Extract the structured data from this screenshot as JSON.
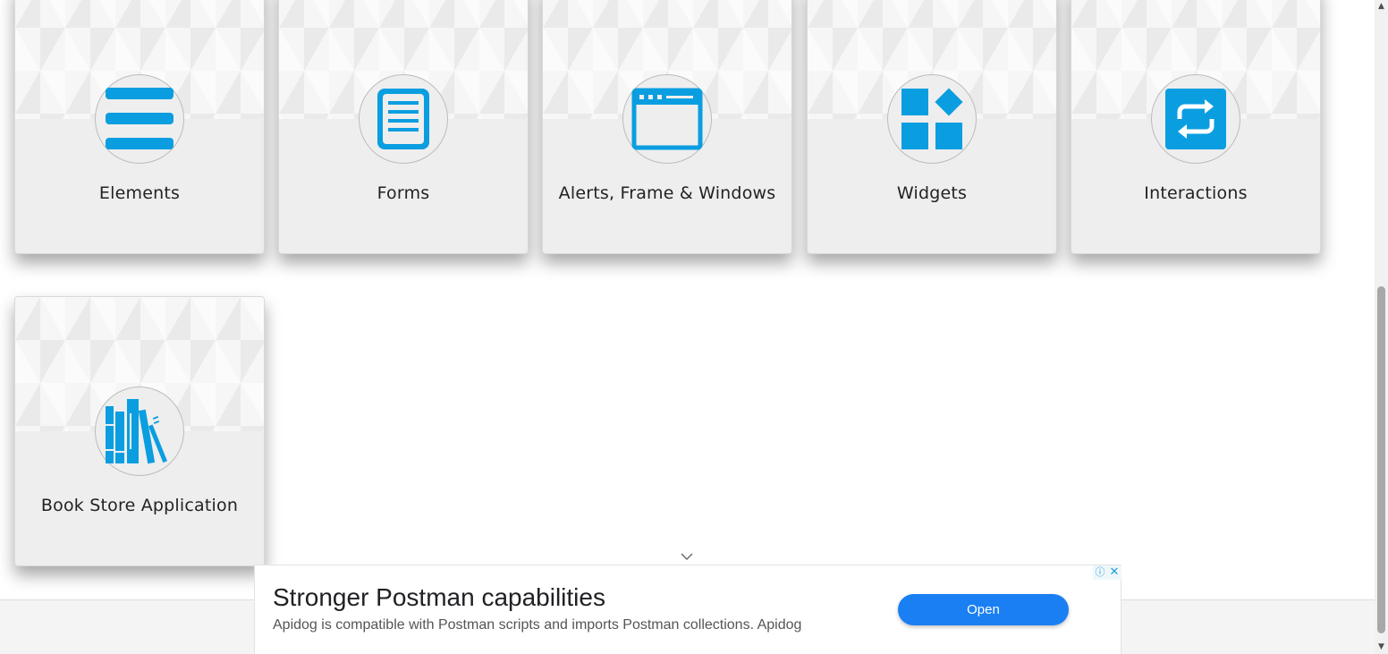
{
  "cards": [
    {
      "title": "Elements",
      "icon": "list-icon"
    },
    {
      "title": "Forms",
      "icon": "document-icon"
    },
    {
      "title": "Alerts, Frame & Windows",
      "icon": "browser-window-icon"
    },
    {
      "title": "Widgets",
      "icon": "widgets-icon"
    },
    {
      "title": "Interactions",
      "icon": "swap-arrows-icon"
    },
    {
      "title": "Book Store Application",
      "icon": "books-icon"
    }
  ],
  "ad": {
    "headline": "Stronger Postman capabilities",
    "description": "Apidog is compatible with Postman scripts and imports Postman collections. Apidog",
    "button_label": "Open",
    "info_glyph": "ⓘ",
    "close_glyph": "✕"
  },
  "scrollbar": {
    "up_glyph": "▲",
    "down_glyph": "▼"
  },
  "colors": {
    "icon_blue": "#0a9ee0",
    "ad_button": "#1a7ff2"
  }
}
